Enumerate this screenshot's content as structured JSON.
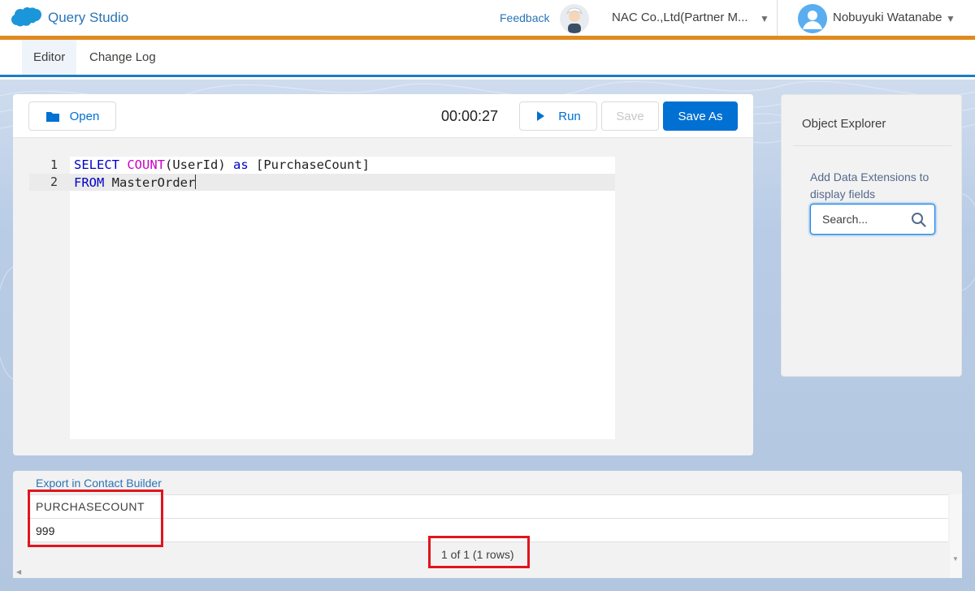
{
  "header": {
    "app_title": "Query Studio",
    "feedback_label": "Feedback",
    "org_name": "NAC Co.,Ltd(Partner M...",
    "user_name": "Nobuyuki Watanabe"
  },
  "tabs": [
    {
      "label": "Editor",
      "active": true
    },
    {
      "label": "Change Log",
      "active": false
    }
  ],
  "toolbar": {
    "open_label": "Open",
    "timer": "00:00:27",
    "run_label": "Run",
    "save_label": "Save",
    "save_as_label": "Save As"
  },
  "editor": {
    "lines": [
      {
        "number": "1",
        "parts": [
          {
            "text": "SELECT ",
            "kind": "kw"
          },
          {
            "text": "COUNT",
            "kind": "fn"
          },
          {
            "text": "(UserId) ",
            "kind": "plain"
          },
          {
            "text": "as",
            "kind": "kw"
          },
          {
            "text": " [PurchaseCount]",
            "kind": "plain"
          }
        ]
      },
      {
        "number": "2",
        "parts": [
          {
            "text": "FROM",
            "kind": "kw"
          },
          {
            "text": " MasterOrder",
            "kind": "plain"
          }
        ]
      }
    ]
  },
  "explorer": {
    "title": "Object Explorer",
    "hint": "Add Data Extensions to display fields",
    "search_placeholder": "Search..."
  },
  "results": {
    "export_link": "Export in Contact Builder",
    "column_header": "PURCHASECOUNT",
    "cell_value": "999",
    "pager": "1 of 1 (1 rows)"
  },
  "colors": {
    "brand_orange": "#e08a1d",
    "primary_blue": "#0070d2",
    "annotation_red": "#e0151d"
  }
}
